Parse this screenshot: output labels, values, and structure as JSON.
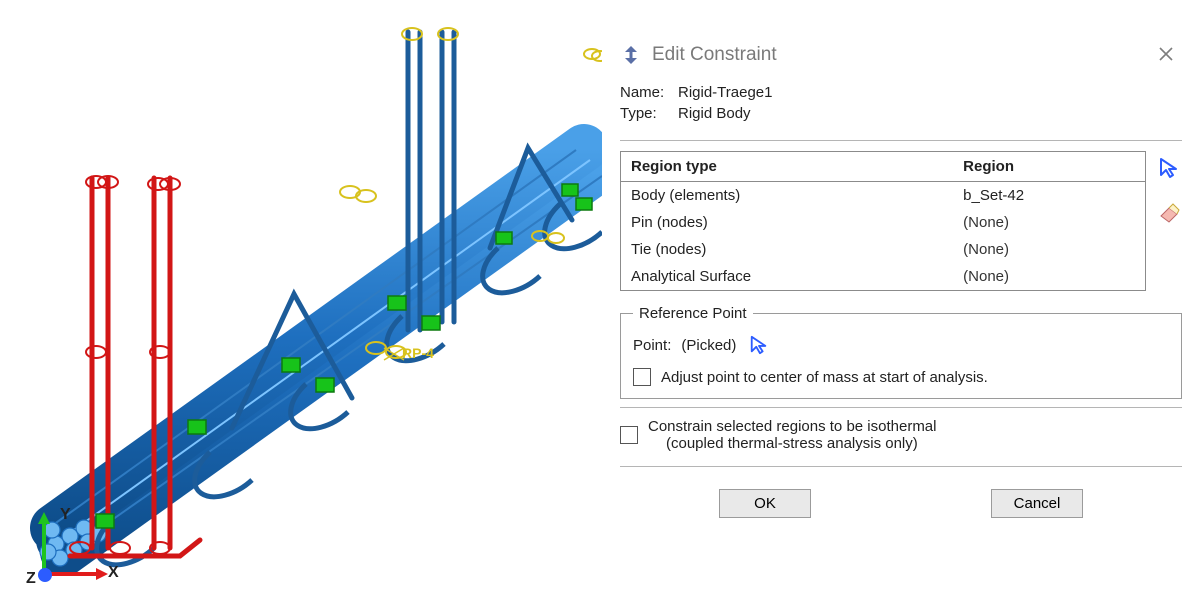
{
  "viewport": {
    "triad": {
      "x": "X",
      "y": "Y",
      "z": "Z"
    },
    "annotation": "RP-4"
  },
  "dialog": {
    "title": "Edit Constraint",
    "name_label": "Name:",
    "name_value": "Rigid-Traege1",
    "type_label": "Type:",
    "type_value": "Rigid Body",
    "region_table": {
      "headers": [
        "Region type",
        "Region"
      ],
      "rows": [
        {
          "type": "Body (elements)",
          "region": "b_Set-42"
        },
        {
          "type": "Pin (nodes)",
          "region": "(None)"
        },
        {
          "type": "Tie (nodes)",
          "region": "(None)"
        },
        {
          "type": "Analytical Surface",
          "region": "(None)"
        }
      ]
    },
    "refpoint": {
      "legend": "Reference Point",
      "point_label": "Point:",
      "point_value": "(Picked)",
      "adjust_label": "Adjust point to center of mass at start of analysis."
    },
    "isothermal": {
      "line1": "Constrain selected regions to be isothermal",
      "line2": "(coupled thermal-stress analysis only)"
    },
    "buttons": {
      "ok": "OK",
      "cancel": "Cancel"
    }
  }
}
